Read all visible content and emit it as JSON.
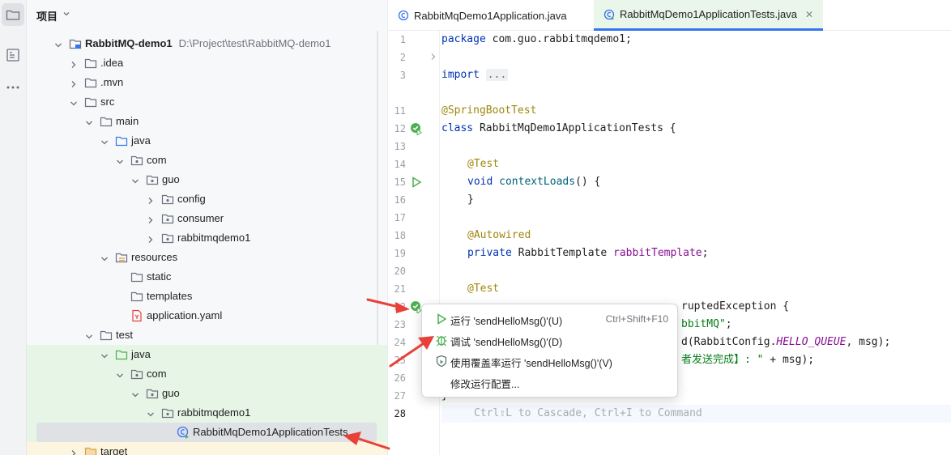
{
  "panel": {
    "title": "项目"
  },
  "tree": [
    {
      "label": "RabbitMQ-demo1",
      "path": "D:\\Project\\test\\RabbitMQ-demo1"
    },
    {
      "label": ".idea"
    },
    {
      "label": ".mvn"
    },
    {
      "label": "src"
    },
    {
      "label": "main"
    },
    {
      "label": "java"
    },
    {
      "label": "com"
    },
    {
      "label": "guo"
    },
    {
      "label": "config"
    },
    {
      "label": "consumer"
    },
    {
      "label": "rabbitmqdemo1"
    },
    {
      "label": "resources"
    },
    {
      "label": "static"
    },
    {
      "label": "templates"
    },
    {
      "label": "application.yaml"
    },
    {
      "label": "test"
    },
    {
      "label": "java"
    },
    {
      "label": "com"
    },
    {
      "label": "guo"
    },
    {
      "label": "rabbitmqdemo1"
    },
    {
      "label": "RabbitMqDemo1ApplicationTests"
    },
    {
      "label": "target"
    }
  ],
  "tabs": [
    {
      "label": "RabbitMqDemo1Application.java"
    },
    {
      "label": "RabbitMqDemo1ApplicationTests.java",
      "close": "✕"
    }
  ],
  "line_numbers": [
    "1",
    "2",
    "3",
    "11",
    "12",
    "13",
    "14",
    "15",
    "16",
    "17",
    "18",
    "19",
    "20",
    "21",
    "22",
    "23",
    "24",
    "25",
    "26",
    "27",
    "28"
  ],
  "code": {
    "l1_kw": "package",
    "l1_rest": " com.guo.rabbitmqdemo1;",
    "l3_kw": "import",
    "l3_fold": "...",
    "l11": "@SpringBootTest",
    "l12_kw": "class",
    "l12_rest": " RabbitMqDemo1ApplicationTests {",
    "l14": "@Test",
    "l15_kw": "void",
    "l15_fn": "contextLoads",
    "l15_rest": "() {",
    "l16": "}",
    "l18": "@Autowired",
    "l19_kw": "private",
    "l19_type": " RabbitTemplate ",
    "l19_fld": "rabbitTemplate",
    "l19_end": ";",
    "l21": "@Test",
    "l22_tail": "ruptedException {",
    "l23_str": "bbitMQ\"",
    "l23_end": ";",
    "l24_pre": "d(RabbitConfig.",
    "l24_cst": "HELLO_QUEUE",
    "l24_end": ", msg);",
    "l25_str": "者发送完成】: \"",
    "l25_end": " + msg);",
    "l27": "}",
    "l28_hint": "Ctrl⇧L to Cascade, Ctrl+I to Command"
  },
  "popup": {
    "items": [
      {
        "label": "运行 'sendHelloMsg()'(U)",
        "shortcut": "Ctrl+Shift+F10"
      },
      {
        "label": "调试 'sendHelloMsg()'(D)"
      },
      {
        "label": "使用覆盖率运行 'sendHelloMsg()'(V)"
      },
      {
        "label": "修改运行配置..."
      }
    ]
  },
  "colors": {
    "accent": "#3574f0",
    "run_green": "#4caf50",
    "annotation_red": "#e8413a"
  }
}
